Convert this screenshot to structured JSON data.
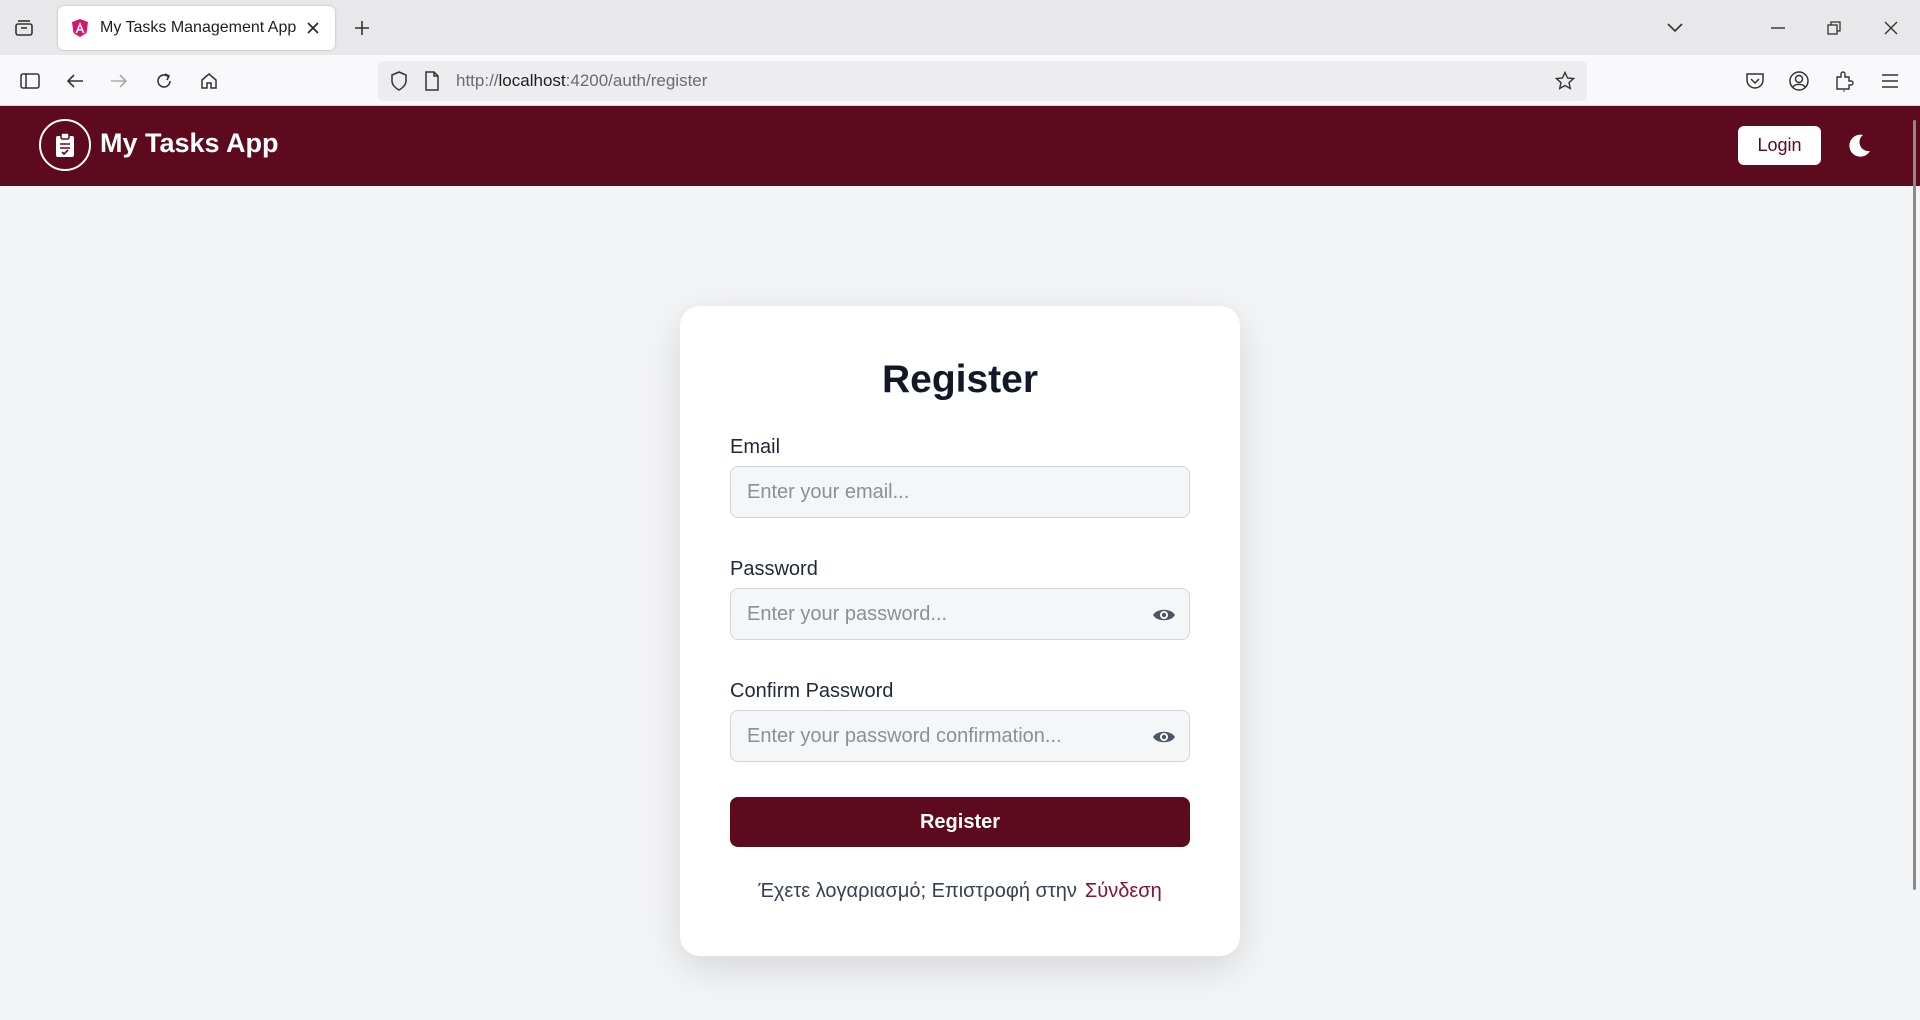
{
  "browser": {
    "tab_title": "My Tasks Management App",
    "url_prefix": "http://",
    "url_host": "localhost",
    "url_path": ":4200/auth/register"
  },
  "header": {
    "app_title": "My Tasks App",
    "login_label": "Login"
  },
  "form": {
    "title": "Register",
    "email_label": "Email",
    "email_placeholder": "Enter your email...",
    "password_label": "Password",
    "password_placeholder": "Enter your password...",
    "confirm_label": "Confirm Password",
    "confirm_placeholder": "Enter your password confirmation...",
    "submit_label": "Register",
    "footer_text": "Έχετε λογαριασμό; Επιστροφή στην",
    "footer_link": "Σύνδεση"
  },
  "colors": {
    "brand": "#5d0a1f",
    "background": "#f3f4f6"
  }
}
